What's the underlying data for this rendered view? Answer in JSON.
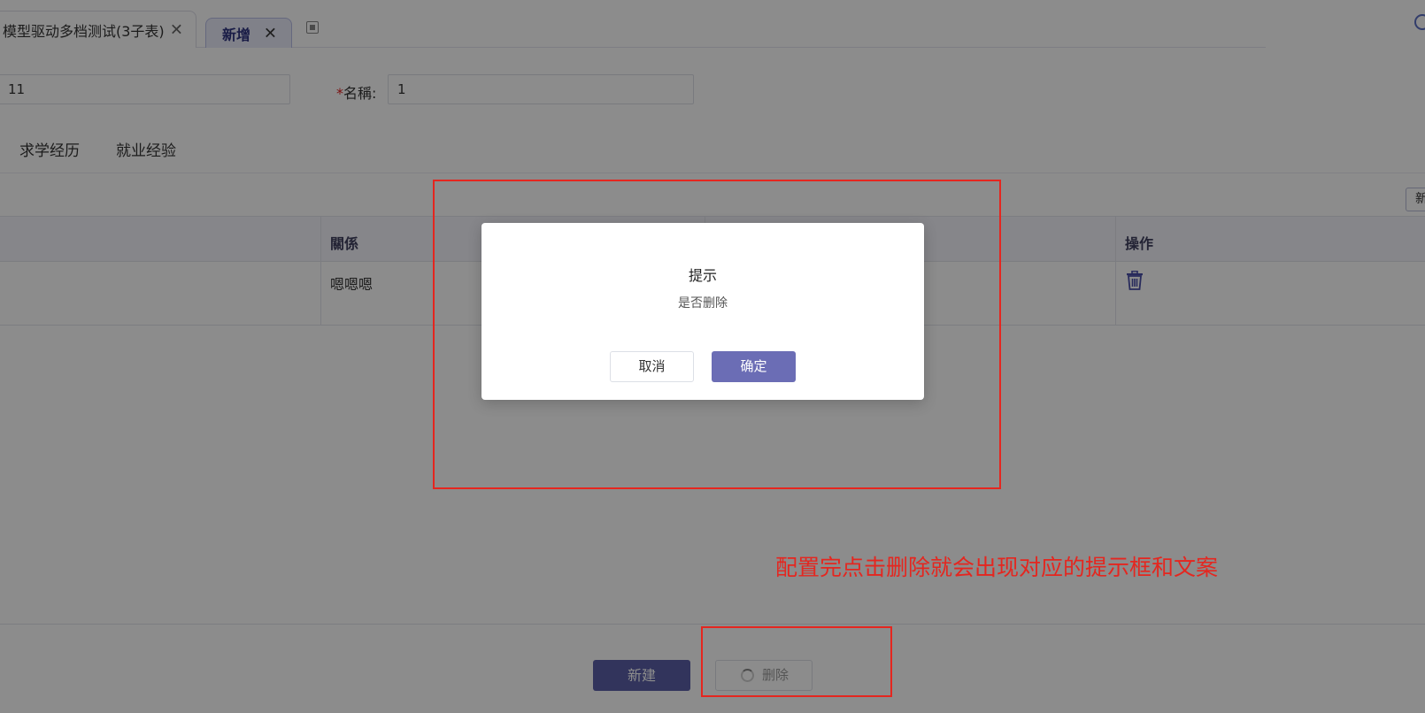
{
  "tabs": [
    {
      "label": "模型驱动多档测试(3子表)",
      "close": "✕"
    },
    {
      "label": "新增",
      "close": "✕"
    }
  ],
  "form": {
    "code_value": "11",
    "name_label_required": "*",
    "name_label": "名稱:",
    "name_value": "1"
  },
  "subtabs": [
    "求学经历",
    "就业经验"
  ],
  "toolbar": {
    "add_partial": "新"
  },
  "table": {
    "headers": {
      "relation": "關係",
      "action": "操作"
    },
    "rows": [
      {
        "relation": "嗯嗯嗯"
      }
    ]
  },
  "footer": {
    "new_button": "新建",
    "delete_button": "删除"
  },
  "dialog": {
    "title": "提示",
    "message": "是否删除",
    "cancel": "取消",
    "confirm": "确定"
  },
  "annotation": {
    "note": "配置完点击删除就会出现对应的提示框和文案",
    "color": "#e5261f"
  },
  "colors": {
    "primary": "#5b5fa8",
    "dialog_confirm": "#6b6db5"
  }
}
